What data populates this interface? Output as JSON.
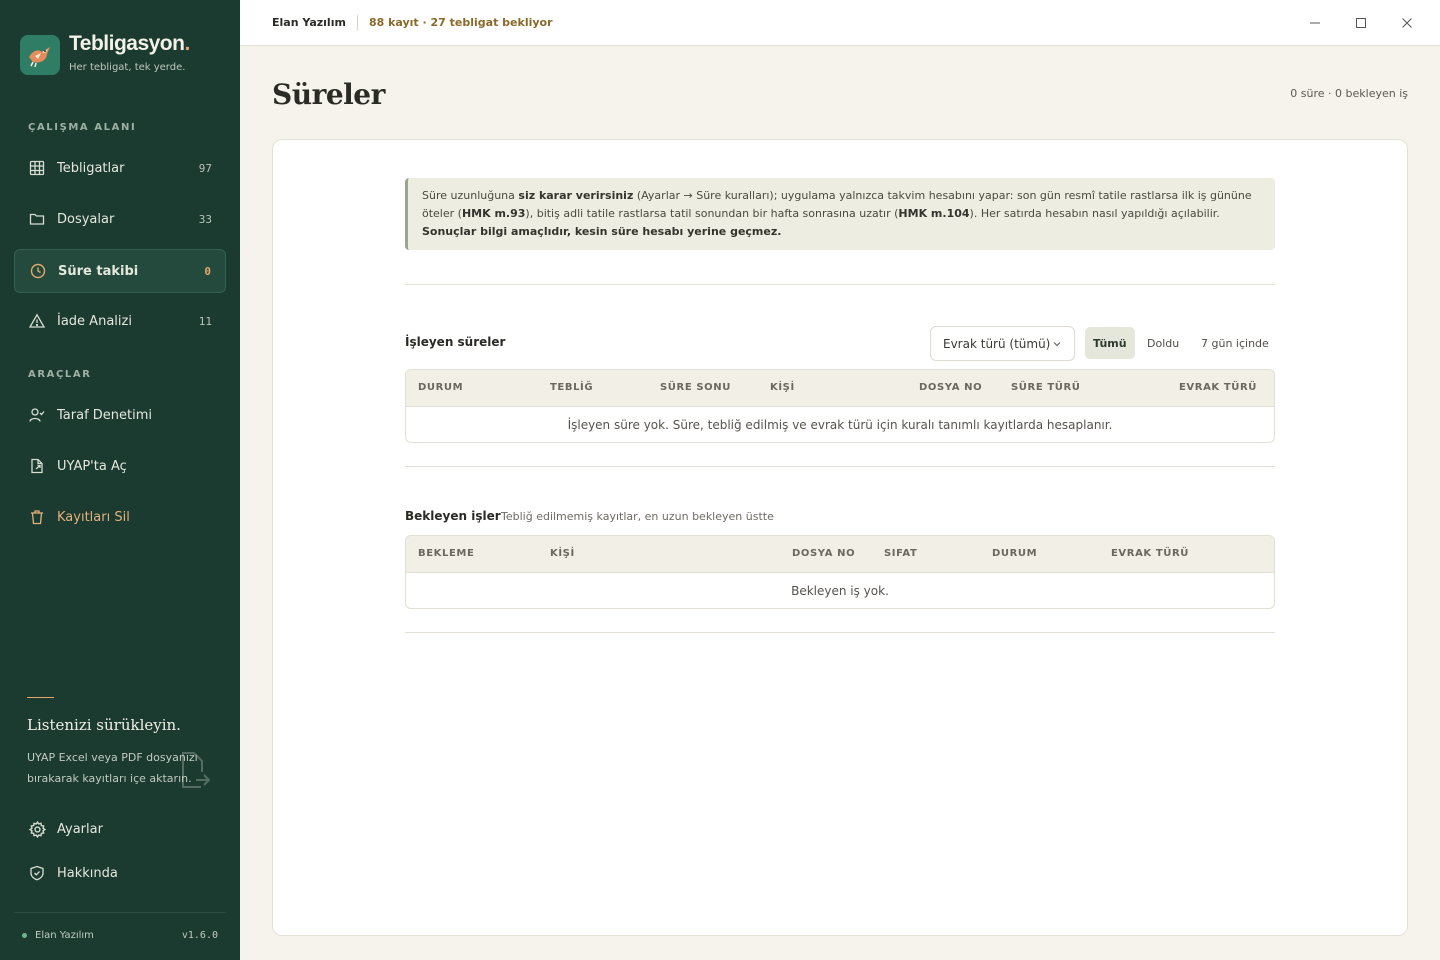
{
  "brand": {
    "name": "Tebligasyon",
    "dot": ".",
    "tagline": "Her tebligat, tek yerde."
  },
  "sidebar": {
    "workspace_label": "ÇALIŞMA ALANI",
    "tools_label": "ARAÇLAR",
    "items": [
      {
        "label": "Tebligatlar",
        "count": "97",
        "icon": "grid-icon"
      },
      {
        "label": "Dosyalar",
        "count": "33",
        "icon": "folder-icon"
      },
      {
        "label": "Süre takibi",
        "count": "0",
        "icon": "clock-icon",
        "active": true
      },
      {
        "label": "İade Analizi",
        "count": "11",
        "icon": "warning-icon"
      }
    ],
    "tools": [
      {
        "label": "Taraf Denetimi",
        "icon": "user-check-icon"
      },
      {
        "label": "UYAP'ta Aç",
        "icon": "external-file-icon"
      },
      {
        "label": "Kayıtları Sil",
        "icon": "trash-icon"
      }
    ],
    "drop": {
      "title": "Listenizi sürükleyin.",
      "text": "UYAP Excel veya PDF dosyanızı bırakarak kayıtları içe aktarın."
    },
    "settings_label": "Ayarlar",
    "about_label": "Hakkında",
    "footer_company": "Elan Yazılım",
    "version": "v1.6.0"
  },
  "topbar": {
    "company": "Elan Yazılım",
    "stats": "88 kayıt · 27 tebligat bekliyor"
  },
  "page": {
    "title": "Süreler",
    "summary": "0 süre · 0 bekleyen iş"
  },
  "info": {
    "t1": "Süre uzunluğuna ",
    "b1": "siz karar verirsiniz",
    "t2": " (Ayarlar → Süre kuralları); uygulama yalnızca takvim hesabını yapar: son gün resmî tatile rastlarsa ilk iş gününe öteler (",
    "b2": "HMK m.93",
    "t3": "), bitiş adli tatile rastlarsa tatil sonundan bir hafta sonrasına uzatır (",
    "b3": "HMK m.104",
    "t4": "). Her satırda hesabın nasıl yapıldığı açılabilir. ",
    "b4": "Sonuçlar bilgi amaçlıdır, kesin süre hesabı yerine geçmez."
  },
  "running": {
    "title": "İşleyen süreler",
    "select_value": "Evrak türü (tümü)",
    "filters": [
      "Tümü",
      "Doldu",
      "7 gün içinde"
    ],
    "columns": [
      "DURUM",
      "TEBLİĞ",
      "SÜRE SONU",
      "KİŞİ",
      "DOSYA NO",
      "SÜRE TÜRÜ",
      "EVRAK TÜRÜ"
    ],
    "empty": "İşleyen süre yok. Süre, tebliğ edilmiş ve evrak türü için kuralı tanımlı kayıtlarda hesaplanır."
  },
  "pending": {
    "title": "Bekleyen işler",
    "subtitle": "Tebliğ edilmemiş kayıtlar, en uzun bekleyen üstte",
    "columns": [
      "BEKLEME",
      "KİŞİ",
      "DOSYA NO",
      "SIFAT",
      "DURUM",
      "EVRAK TÜRÜ"
    ],
    "empty": "Bekleyen iş yok."
  },
  "colors": {
    "sidebar_bg": "#1b3a30",
    "accent": "#e3a86b",
    "brand_green": "#2f7d64"
  }
}
